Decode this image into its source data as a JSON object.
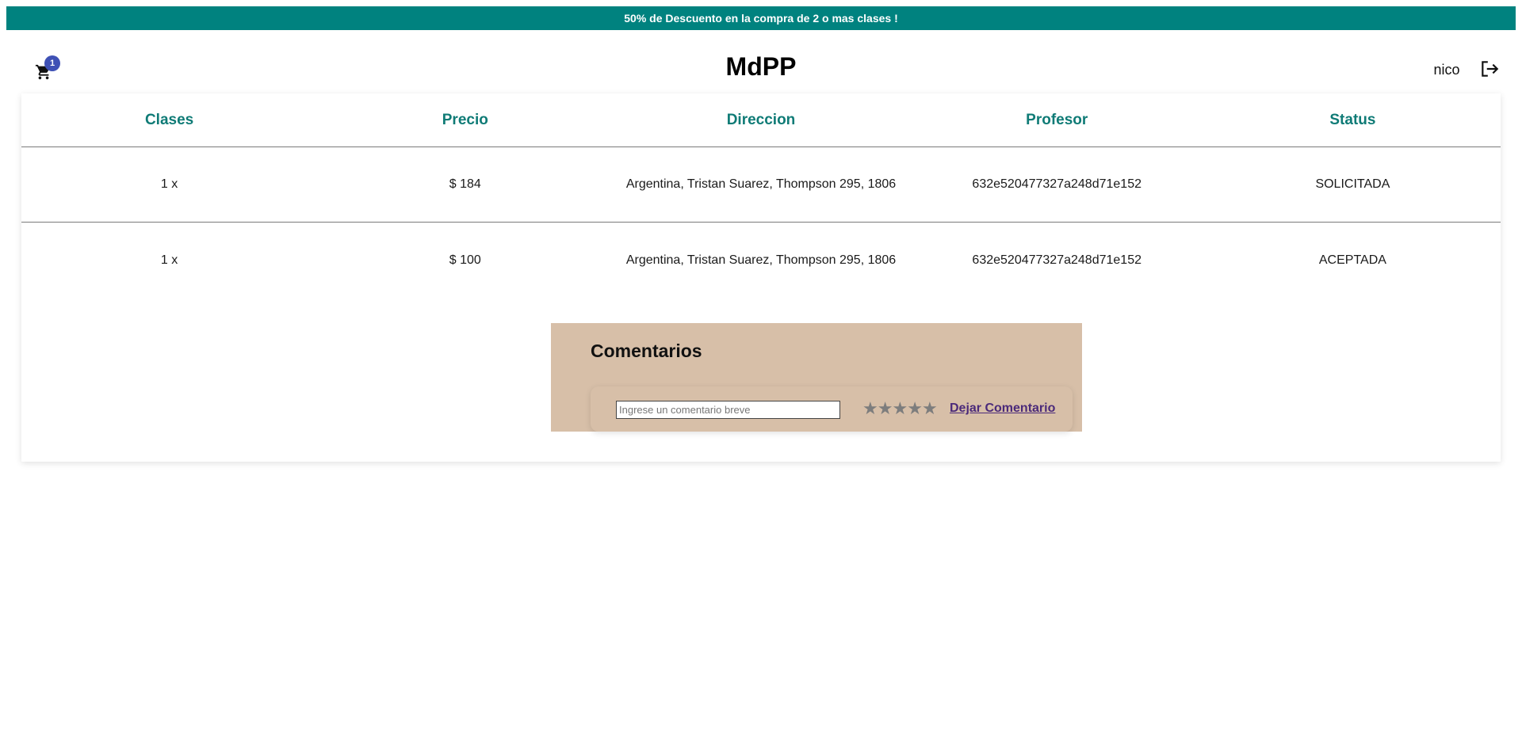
{
  "promo": {
    "text": "50% de Descuento en la compra de 2 o mas clases !"
  },
  "header": {
    "cart_icon": "shopping-cart-icon",
    "cart_count": "1",
    "brand": "MdPP",
    "username": "nico",
    "logout_icon": "logout-icon"
  },
  "table": {
    "headers": [
      "Clases",
      "Precio",
      "Direccion",
      "Profesor",
      "Status"
    ],
    "rows": [
      [
        "1 x",
        "$ 184",
        "Argentina, Tristan Suarez, Thompson 295, 1806",
        "632e520477327a248d71e152",
        "SOLICITADA"
      ],
      [
        "1 x",
        "$ 100",
        "Argentina, Tristan Suarez, Thompson 295, 1806",
        "632e520477327a248d71e152",
        "ACEPTADA"
      ]
    ]
  },
  "comments": {
    "title": "Comentarios",
    "input_placeholder": "Ingrese un comentario breve",
    "stars": "★★★★★",
    "rating": 0,
    "rating_max": 5,
    "submit_label": "Dejar Comentario"
  },
  "colors": {
    "accent": "#00827f",
    "header_text": "#0f7b76",
    "badge": "#3f51b5",
    "comments_bg": "#d7bfa8",
    "link": "#4b2a7a"
  }
}
